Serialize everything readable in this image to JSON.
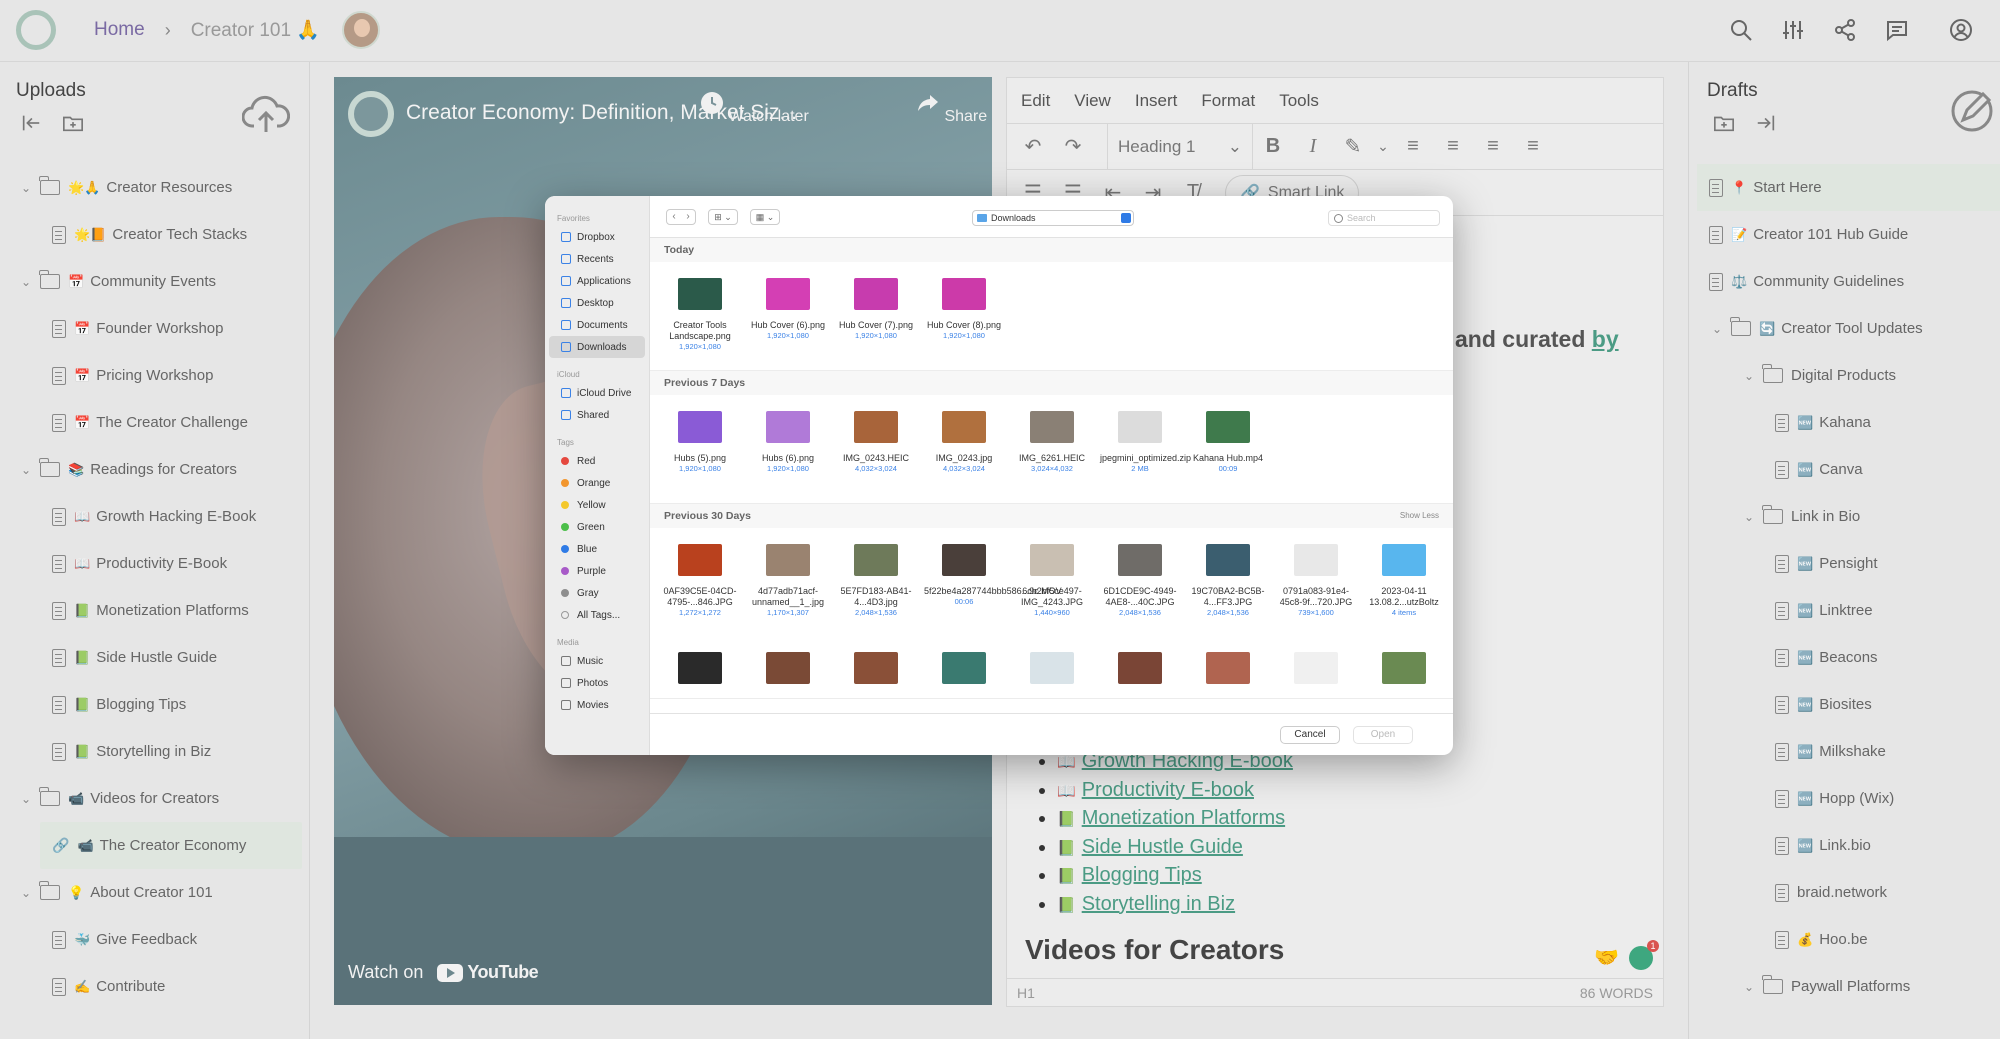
{
  "topbar": {
    "home": "Home",
    "current": "Creator 101",
    "current_emoji": "🙏",
    "icons": [
      "search-icon",
      "sliders-icon",
      "share-icon",
      "comment-icon",
      "profile-icon"
    ]
  },
  "left": {
    "title": "Uploads",
    "items": [
      {
        "label": "Creator Resources",
        "emoji": "🌟🙏",
        "type": "folder",
        "level": 0
      },
      {
        "label": "Creator Tech Stacks",
        "emoji": "🌟📙",
        "type": "doc",
        "level": 1
      },
      {
        "label": "Community Events",
        "emoji": "📅",
        "type": "folder",
        "level": 0
      },
      {
        "label": "Founder Workshop",
        "emoji": "📅",
        "type": "doc",
        "level": 1
      },
      {
        "label": "Pricing Workshop",
        "emoji": "📅",
        "type": "doc",
        "level": 1
      },
      {
        "label": "The Creator Challenge",
        "emoji": "📅",
        "type": "doc",
        "level": 1
      },
      {
        "label": "Readings for Creators",
        "emoji": "📚",
        "type": "folder",
        "level": 0
      },
      {
        "label": "Growth Hacking E-Book",
        "emoji": "📖",
        "type": "doc",
        "level": 1
      },
      {
        "label": "Productivity E-Book",
        "emoji": "📖",
        "type": "doc",
        "level": 1
      },
      {
        "label": "Monetization Platforms",
        "emoji": "📗",
        "type": "doc",
        "level": 1
      },
      {
        "label": "Side Hustle Guide",
        "emoji": "📗",
        "type": "doc",
        "level": 1
      },
      {
        "label": "Blogging Tips",
        "emoji": "📗",
        "type": "doc",
        "level": 1
      },
      {
        "label": "Storytelling in Biz",
        "emoji": "📗",
        "type": "doc",
        "level": 1
      },
      {
        "label": "Videos for Creators",
        "emoji": "📹",
        "type": "folder",
        "level": 0
      },
      {
        "label": "The Creator Economy",
        "emoji": "📹",
        "type": "link",
        "level": 1,
        "selected": true
      },
      {
        "label": "About Creator 101",
        "emoji": "💡",
        "type": "folder",
        "level": 0
      },
      {
        "label": "Give Feedback",
        "emoji": "🐳",
        "type": "doc",
        "level": 1
      },
      {
        "label": "Contribute",
        "emoji": "✍️",
        "type": "doc",
        "level": 1
      }
    ]
  },
  "video": {
    "title": "Creator Economy: Definition, Market Siz...",
    "watch_later": "Watch later",
    "share": "Share",
    "watch_on": "Watch on",
    "youtube": "YouTube"
  },
  "editor": {
    "menu": [
      "Edit",
      "View",
      "Insert",
      "Format",
      "Tools"
    ],
    "heading_select": "Heading 1",
    "smart_link": "Smart Link",
    "intro": "and curated",
    "intro_link": "by",
    "list": [
      {
        "emoji": "📖",
        "label": "Growth Hacking E-book"
      },
      {
        "emoji": "📖",
        "label": "Productivity E-book"
      },
      {
        "emoji": "📗",
        "label": "Monetization Platforms"
      },
      {
        "emoji": "📗",
        "label": "Side Hustle Guide"
      },
      {
        "emoji": "📗",
        "label": "Blogging Tips"
      },
      {
        "emoji": "📗",
        "label": "Storytelling in Biz"
      }
    ],
    "heading2": "Videos for Creators",
    "status_block": "H1",
    "word_count": "86 WORDS",
    "grammar_badge": "1"
  },
  "right": {
    "title": "Drafts",
    "items": [
      {
        "label": "Start Here",
        "emoji": "📍",
        "type": "doc",
        "level": 1,
        "selected": true
      },
      {
        "label": "Creator 101 Hub Guide",
        "emoji": "📝",
        "type": "doc",
        "level": 1
      },
      {
        "label": "Community Guidelines",
        "emoji": "⚖️",
        "type": "doc",
        "level": 1
      },
      {
        "label": "Creator Tool Updates",
        "emoji": "🔄",
        "type": "folder",
        "level": 1
      },
      {
        "label": "Digital Products",
        "emoji": "",
        "type": "folder",
        "level": 2
      },
      {
        "label": "Kahana",
        "emoji": "🆕",
        "type": "doc",
        "level": 3
      },
      {
        "label": "Canva",
        "emoji": "🆕",
        "type": "doc",
        "level": 3
      },
      {
        "label": "Link in Bio",
        "emoji": "",
        "type": "folder",
        "level": 2
      },
      {
        "label": "Pensight",
        "emoji": "🆕",
        "type": "doc",
        "level": 3
      },
      {
        "label": "Linktree",
        "emoji": "🆕",
        "type": "doc",
        "level": 3
      },
      {
        "label": "Beacons",
        "emoji": "🆕",
        "type": "doc",
        "level": 3
      },
      {
        "label": "Biosites",
        "emoji": "🆕",
        "type": "doc",
        "level": 3
      },
      {
        "label": "Milkshake",
        "emoji": "🆕",
        "type": "doc",
        "level": 3
      },
      {
        "label": "Hopp (Wix)",
        "emoji": "🆕",
        "type": "doc",
        "level": 3
      },
      {
        "label": "Link.bio",
        "emoji": "🆕",
        "type": "doc",
        "level": 3
      },
      {
        "label": "braid.network",
        "emoji": "",
        "type": "doc",
        "level": 3
      },
      {
        "label": "Hoo.be",
        "emoji": "💰",
        "type": "doc",
        "level": 3
      },
      {
        "label": "Paywall Platforms",
        "emoji": "",
        "type": "folder",
        "level": 2
      }
    ]
  },
  "dialog": {
    "location": "Downloads",
    "search_placeholder": "Search",
    "sidebar": {
      "favorites_label": "Favorites",
      "favorites": [
        "Dropbox",
        "Recents",
        "Applications",
        "Desktop",
        "Documents",
        "Downloads"
      ],
      "icloud_label": "iCloud",
      "icloud": [
        "iCloud Drive",
        "Shared"
      ],
      "tags_label": "Tags",
      "tags": [
        {
          "name": "Red",
          "color": "#e5483f"
        },
        {
          "name": "Orange",
          "color": "#f2962e"
        },
        {
          "name": "Yellow",
          "color": "#f4c82c"
        },
        {
          "name": "Green",
          "color": "#4cbf4a"
        },
        {
          "name": "Blue",
          "color": "#2f7be6"
        },
        {
          "name": "Purple",
          "color": "#a85ac8"
        },
        {
          "name": "Gray",
          "color": "#8e8e8e"
        }
      ],
      "all_tags": "All Tags...",
      "media_label": "Media",
      "media": [
        "Music",
        "Photos",
        "Movies"
      ]
    },
    "groups": [
      {
        "title": "Today",
        "files": [
          {
            "name": "Creator Tools Landscape.png",
            "meta": "1,920×1,080",
            "color": "#2b5a4a"
          },
          {
            "name": "Hub Cover (6).png",
            "meta": "1,920×1,080",
            "color": "#d43fb4"
          },
          {
            "name": "Hub Cover (7).png",
            "meta": "1,920×1,080",
            "color": "#c73cae"
          },
          {
            "name": "Hub Cover (8).png",
            "meta": "1,920×1,080",
            "color": "#cc3aa9"
          }
        ]
      },
      {
        "title": "Previous 7 Days",
        "files": [
          {
            "name": "Hubs (5).png",
            "meta": "1,920×1,080",
            "color": "#8a5bd6"
          },
          {
            "name": "Hubs (6).png",
            "meta": "1,920×1,080",
            "color": "#b07ad8"
          },
          {
            "name": "IMG_0243.HEIC",
            "meta": "4,032×3,024",
            "color": "#a8643a"
          },
          {
            "name": "IMG_0243.jpg",
            "meta": "4,032×3,024",
            "color": "#b0703e"
          },
          {
            "name": "IMG_6261.HEIC",
            "meta": "3,024×4,032",
            "color": "#8a8075"
          },
          {
            "name": "jpegmini_optimized.zip",
            "meta": "2 MB",
            "color": "#dcdcdc"
          },
          {
            "name": "Kahana Hub.mp4",
            "meta": "00:09",
            "color": "#3f7a4c"
          }
        ]
      },
      {
        "title": "Previous 30 Days",
        "show_less": "Show Less",
        "files": [
          {
            "name": "0AF39C5E-04CD-4795-...846.JPG",
            "meta": "1,272×1,272",
            "color": "#b9411e"
          },
          {
            "name": "4d77adb71acf-unnamed__1_.jpg",
            "meta": "1,170×1,307",
            "color": "#9a8370"
          },
          {
            "name": "5E7FD183-AB41-4...4D3.jpg",
            "meta": "2,048×1,536",
            "color": "#6e7a5a"
          },
          {
            "name": "5f22be4a287744bbb586...9c.MOV",
            "meta": "00:06",
            "color": "#4a3f3a"
          },
          {
            "name": "6cb2bf5ce497-IMG_4243.JPG",
            "meta": "1,440×960",
            "color": "#c9bfb2"
          },
          {
            "name": "6D1CDE9C-4949-4AE8-...40C.JPG",
            "meta": "2,048×1,536",
            "color": "#6f6c68"
          },
          {
            "name": "19C70BA2-BC5B-4...FF3.JPG",
            "meta": "2,048×1,536",
            "color": "#3b5e6f"
          },
          {
            "name": "0791a083-91e4-45c8-9f...720.JPG",
            "meta": "739×1,600",
            "color": "#e8e8e8"
          },
          {
            "name": "2023-04-11 13.08.2...utzBoltz",
            "meta": "4 items",
            "color": "#58b6ee"
          }
        ],
        "more": [
          {
            "color": "#2a2a2a"
          },
          {
            "color": "#7a4a36"
          },
          {
            "color": "#8a5038"
          },
          {
            "color": "#3a7a70"
          },
          {
            "color": "#d9e3e8"
          },
          {
            "color": "#7a4536"
          },
          {
            "color": "#b06450"
          },
          {
            "color": "#f0f0f0"
          },
          {
            "color": "#6a8a52"
          }
        ]
      }
    ],
    "cancel": "Cancel",
    "open": "Open"
  }
}
